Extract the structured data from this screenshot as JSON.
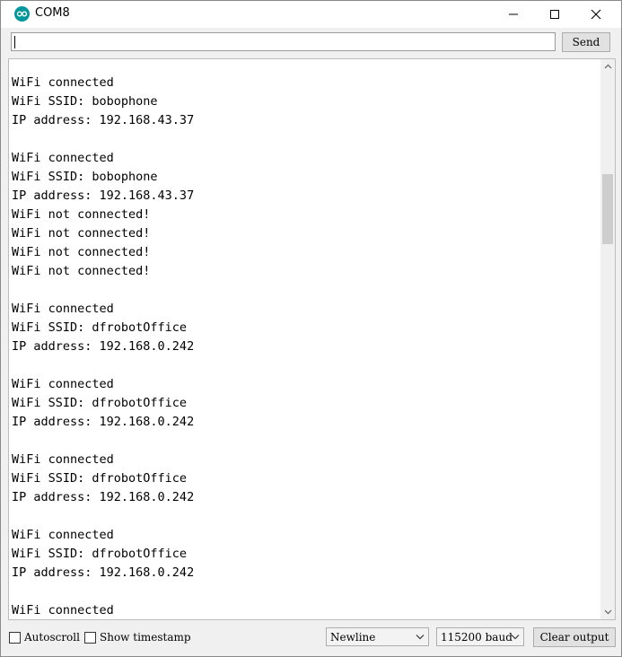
{
  "window": {
    "title": "COM8",
    "icon": "arduino-icon"
  },
  "send_row": {
    "input_value": "",
    "send_label": "Send"
  },
  "output": {
    "lines": [
      "WiFi connected",
      "WiFi SSID: bobophone",
      "IP address: 192.168.43.37",
      "",
      "WiFi connected",
      "WiFi SSID: bobophone",
      "IP address: 192.168.43.37",
      "WiFi not connected!",
      "WiFi not connected!",
      "WiFi not connected!",
      "WiFi not connected!",
      "",
      "WiFi connected",
      "WiFi SSID: dfrobotOffice",
      "IP address: 192.168.0.242",
      "",
      "WiFi connected",
      "WiFi SSID: dfrobotOffice",
      "IP address: 192.168.0.242",
      "",
      "WiFi connected",
      "WiFi SSID: dfrobotOffice",
      "IP address: 192.168.0.242",
      "",
      "WiFi connected",
      "WiFi SSID: dfrobotOffice",
      "IP address: 192.168.0.242",
      "",
      "WiFi connected"
    ]
  },
  "bottom_bar": {
    "autoscroll_label": "Autoscroll",
    "autoscroll_checked": false,
    "timestamp_label": "Show timestamp",
    "timestamp_checked": false,
    "line_ending_value": "Newline",
    "baud_value": "115200 baud",
    "clear_label": "Clear output"
  }
}
